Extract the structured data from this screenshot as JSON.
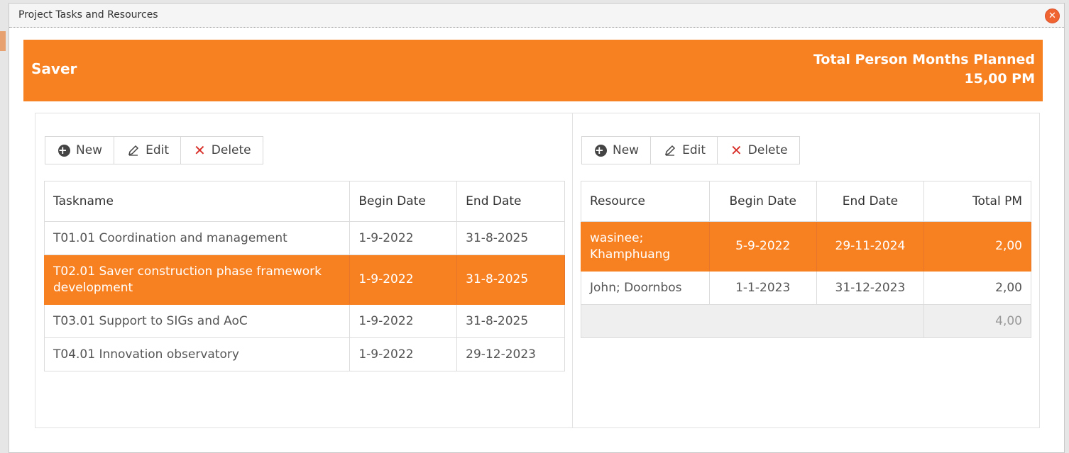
{
  "window": {
    "title": "Project Tasks and Resources"
  },
  "banner": {
    "project": "Saver",
    "total_label": "Total Person Months Planned",
    "total_value": "15,00 PM"
  },
  "toolbar": {
    "new_label": "New",
    "edit_label": "Edit",
    "delete_label": "Delete"
  },
  "tasks": {
    "headers": [
      "Taskname",
      "Begin Date",
      "End Date"
    ],
    "rows": [
      {
        "name": "T01.01 Coordination and management",
        "begin": "1-9-2022",
        "end": "31-8-2025"
      },
      {
        "name": "T02.01 Saver construction phase framework development",
        "begin": "1-9-2022",
        "end": "31-8-2025"
      },
      {
        "name": "T03.01 Support to SIGs and AoC",
        "begin": "1-9-2022",
        "end": "31-8-2025"
      },
      {
        "name": "T04.01 Innovation observatory",
        "begin": "1-9-2022",
        "end": "29-12-2023"
      }
    ]
  },
  "resources": {
    "headers": [
      "Resource",
      "Begin Date",
      "End Date",
      "Total PM"
    ],
    "rows": [
      {
        "name": "wasinee; Khamphuang",
        "begin": "5-9-2022",
        "end": "29-11-2024",
        "pm": "2,00"
      },
      {
        "name": "John; Doornbos",
        "begin": "1-1-2023",
        "end": "31-12-2023",
        "pm": "2,00"
      }
    ],
    "total": "4,00"
  },
  "colors": {
    "accent": "#f78021",
    "close": "#f06432",
    "delete": "#d9322c"
  }
}
